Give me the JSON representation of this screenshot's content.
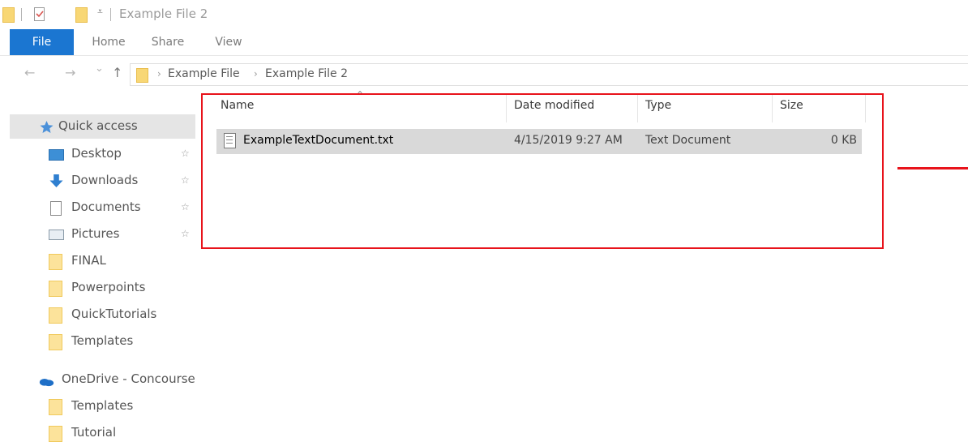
{
  "window": {
    "title": "Example File 2",
    "quick_access_dropdown": "⩡"
  },
  "ribbon": {
    "tabs": [
      "File",
      "Home",
      "Share",
      "View"
    ],
    "active_tab": "File",
    "active_color": "#1b76d1"
  },
  "address_bar": {
    "back": "←",
    "forward": "→",
    "recent": "⌄",
    "up": "↑",
    "breadcrumb": [
      "Example File",
      "Example File 2"
    ],
    "separator": "›"
  },
  "nav_pane": {
    "quick_access": "Quick access",
    "items": [
      {
        "label": "Desktop",
        "icon": "desktop-icon",
        "pinned": true
      },
      {
        "label": "Downloads",
        "icon": "downloads-icon",
        "pinned": true
      },
      {
        "label": "Documents",
        "icon": "documents-icon",
        "pinned": true
      },
      {
        "label": "Pictures",
        "icon": "pictures-icon",
        "pinned": true
      },
      {
        "label": "FINAL",
        "icon": "folder-icon",
        "pinned": false
      },
      {
        "label": "Powerpoints",
        "icon": "folder-icon",
        "pinned": false
      },
      {
        "label": "QuickTutorials",
        "icon": "folder-icon",
        "pinned": false
      },
      {
        "label": "Templates",
        "icon": "folder-icon",
        "pinned": false
      }
    ],
    "onedrive": "OneDrive - Concourse",
    "onedrive_items": [
      {
        "label": "Templates",
        "icon": "folder-icon"
      },
      {
        "label": "Tutorial",
        "icon": "folder-icon"
      }
    ],
    "pin_glyph": "☆"
  },
  "file_list": {
    "columns": [
      "Name",
      "Date modified",
      "Type",
      "Size"
    ],
    "rows": [
      {
        "name": "ExampleTextDocument.txt",
        "date_modified": "4/15/2019 9:27 AM",
        "type": "Text Document",
        "size": "0 KB"
      }
    ]
  },
  "annotation_color": "#e8131b"
}
